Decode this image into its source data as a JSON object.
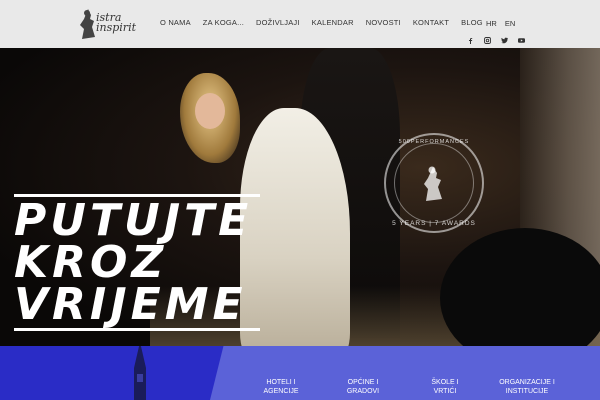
{
  "header": {
    "logo_text_1": "istra",
    "logo_text_2": "inspirit",
    "nav": [
      "O NAMA",
      "ZA KOGA...",
      "DOŽIVLJAJI",
      "KALENDAR",
      "NOVOSTI",
      "KONTAKT",
      "BLOG"
    ],
    "languages": [
      "HR",
      "EN"
    ],
    "social_icons": [
      "facebook-icon",
      "instagram-icon",
      "twitter-icon",
      "youtube-icon"
    ]
  },
  "hero": {
    "headline": [
      "PUTUJTE",
      "KROZ",
      "VRIJEME"
    ],
    "badge_top": "500PERFORMANCES",
    "badge_bottom": "5 YEARS | 7 AWARDS"
  },
  "categories": [
    {
      "line1": "HOTELI I",
      "line2": "AGENCIJE"
    },
    {
      "line1": "OPĆINE I",
      "line2": "GRADOVI"
    },
    {
      "line1": "ŠKOLE I",
      "line2": "VRTIĆI"
    },
    {
      "line1": "ORGANIZACIJE I",
      "line2": "INSTITUCIJE"
    }
  ],
  "colors": {
    "header_bg": "#e9e9e9",
    "strip_left": "#2a2cc6",
    "strip_right": "#5b62d8"
  }
}
